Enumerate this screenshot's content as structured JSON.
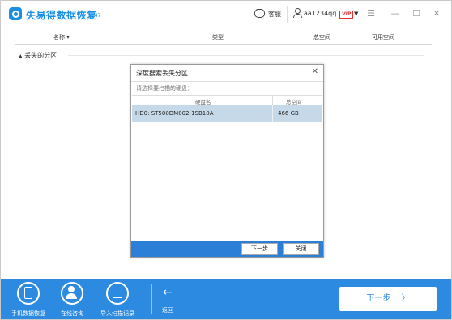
{
  "app": {
    "title": "失易得数据恢复",
    "version": "6.47"
  },
  "titlebar": {
    "support_label": "客服",
    "username": "aa1234qq",
    "vip_badge": "VIP"
  },
  "table": {
    "columns": [
      "名称",
      "类型",
      "总空间",
      "可用空间"
    ],
    "group_label": "丢失的分区"
  },
  "dialog": {
    "title": "深度搜索丢失分区",
    "prompt": "请选择要扫描的硬盘：",
    "columns": [
      "硬盘名",
      "总空间"
    ],
    "rows": [
      {
        "name": "HD0: ST500DM002-1SB10A",
        "size": "466 GB"
      }
    ],
    "next_label": "下一步",
    "close_label": "关闭"
  },
  "bottombar": {
    "items": [
      {
        "label": "手机数据恢复",
        "icon": "phone-icon"
      },
      {
        "label": "在线咨询",
        "icon": "consult-icon"
      },
      {
        "label": "导入扫描记录",
        "icon": "import-icon"
      }
    ],
    "back_label": "返回",
    "next_label": "下一步"
  },
  "colors": {
    "accent": "#2c8ae0",
    "selected_row": "#c6d9e8",
    "vip": "#e03030"
  }
}
